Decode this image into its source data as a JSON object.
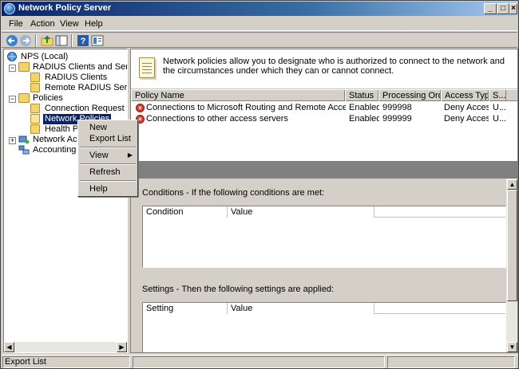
{
  "window": {
    "title": "Network Policy Server"
  },
  "menu": [
    "File",
    "Action",
    "View",
    "Help"
  ],
  "toolbar_icons": [
    "back-icon",
    "forward-icon",
    "up-folder-icon",
    "show-hide-tree-icon",
    "help-icon",
    "properties-icon"
  ],
  "tree": {
    "root": "NPS (Local)",
    "radius_clients_servers": "RADIUS Clients and Servers",
    "radius_clients": "RADIUS Clients",
    "remote_radius": "Remote RADIUS Server G",
    "policies": "Policies",
    "connection_request": "Connection Request Polici",
    "network_policies": "Network Policies",
    "health_policies": "Health Poli",
    "network_access": "Network Acces",
    "accounting": "Accounting"
  },
  "context_menu": {
    "new": "New",
    "export_list": "Export List",
    "view": "View",
    "refresh": "Refresh",
    "help": "Help"
  },
  "info_text": "Network policies allow you to designate who is authorized to connect to the network and the circumstances under which they can or cannot connect.",
  "policy_table": {
    "columns": [
      "Policy Name",
      "Status",
      "Processing Order",
      "Access Type",
      "S..."
    ],
    "rows": [
      [
        "Connections to Microsoft Routing and Remote Access server",
        "Enabled",
        "999998",
        "Deny Access",
        "U..."
      ],
      [
        "Connections to other access servers",
        "Enabled",
        "999999",
        "Deny Access",
        "U..."
      ]
    ]
  },
  "conditions": {
    "title": "Conditions - If the following conditions are met:",
    "columns": [
      "Condition",
      "Value"
    ]
  },
  "settings": {
    "title": "Settings - Then the following settings are applied:",
    "columns": [
      "Setting",
      "Value"
    ]
  },
  "status_bar": {
    "text": "Export List"
  },
  "colors": {
    "title_bar": "#0a246a",
    "selection": "#0a246a",
    "deny_icon": "#d53a2c"
  }
}
